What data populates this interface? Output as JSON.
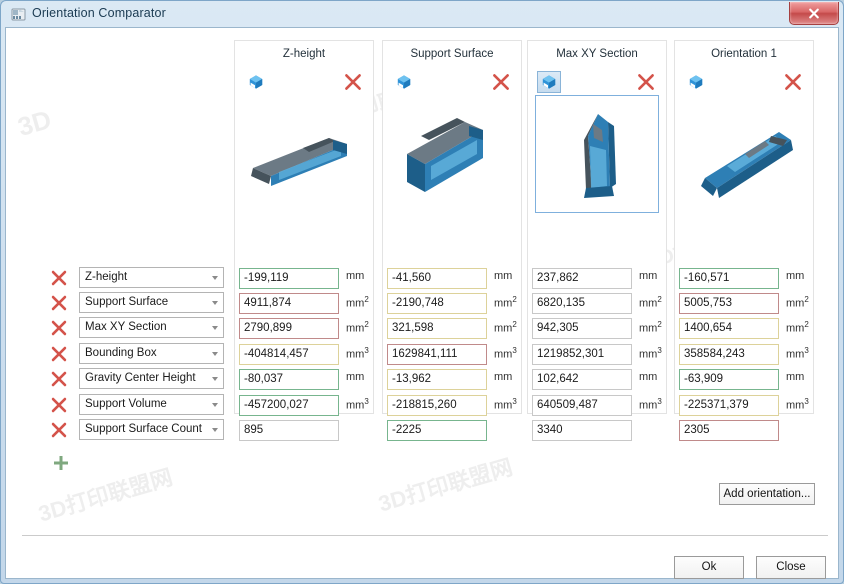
{
  "window": {
    "title": "Orientation Comparator",
    "title_icon": "app-window-icon",
    "close_icon": "close-icon"
  },
  "columns": [
    {
      "title": "Z-height",
      "cube_icon": "orientation-cube-icon",
      "remove_icon": "remove-column-icon",
      "selected": false
    },
    {
      "title": "Support Surface",
      "cube_icon": "orientation-cube-icon",
      "remove_icon": "remove-column-icon",
      "selected": false
    },
    {
      "title": "Max XY Section",
      "cube_icon": "orientation-cube-icon",
      "remove_icon": "remove-column-icon",
      "selected": true
    },
    {
      "title": "Orientation 1",
      "cube_icon": "orientation-cube-icon",
      "remove_icon": "remove-column-icon",
      "selected": false
    }
  ],
  "criteria": [
    {
      "label": "Z-height",
      "unit": "mm",
      "unit_exp": ""
    },
    {
      "label": "Support Surface",
      "unit": "mm",
      "unit_exp": "2"
    },
    {
      "label": "Max XY Section",
      "unit": "mm",
      "unit_exp": "2"
    },
    {
      "label": "Bounding Box",
      "unit": "mm",
      "unit_exp": "3"
    },
    {
      "label": "Gravity Center Height",
      "unit": "mm",
      "unit_exp": ""
    },
    {
      "label": "Support Volume",
      "unit": "mm",
      "unit_exp": "3"
    },
    {
      "label": "Support Surface Count",
      "unit": "",
      "unit_exp": ""
    }
  ],
  "values": [
    [
      {
        "v": "-199,119",
        "state": "good"
      },
      {
        "v": "4911,874",
        "state": "bad"
      },
      {
        "v": "2790,899",
        "state": "bad"
      },
      {
        "v": "-404814,457",
        "state": "mid"
      },
      {
        "v": "-80,037",
        "state": "good"
      },
      {
        "v": "-457200,027",
        "state": "good"
      },
      {
        "v": "895",
        "state": "plain"
      }
    ],
    [
      {
        "v": "-41,560",
        "state": "mid"
      },
      {
        "v": "-2190,748",
        "state": "mid"
      },
      {
        "v": "321,598",
        "state": "mid"
      },
      {
        "v": "1629841,111",
        "state": "bad"
      },
      {
        "v": "-13,962",
        "state": "mid"
      },
      {
        "v": "-218815,260",
        "state": "mid"
      },
      {
        "v": "-2225",
        "state": "good"
      }
    ],
    [
      {
        "v": "237,862",
        "state": "plain"
      },
      {
        "v": "6820,135",
        "state": "plain"
      },
      {
        "v": "942,305",
        "state": "plain"
      },
      {
        "v": "1219852,301",
        "state": "plain"
      },
      {
        "v": "102,642",
        "state": "plain"
      },
      {
        "v": "640509,487",
        "state": "plain"
      },
      {
        "v": "3340",
        "state": "plain"
      }
    ],
    [
      {
        "v": "-160,571",
        "state": "good"
      },
      {
        "v": "5005,753",
        "state": "bad"
      },
      {
        "v": "1400,654",
        "state": "mid"
      },
      {
        "v": "358584,243",
        "state": "mid"
      },
      {
        "v": "-63,909",
        "state": "good"
      },
      {
        "v": "-225371,379",
        "state": "mid"
      },
      {
        "v": "2305",
        "state": "bad"
      }
    ]
  ],
  "actions": {
    "add_criterion_icon": "plus-icon",
    "add_orientation_label": "Add orientation...",
    "ok_label": "Ok",
    "close_label": "Close"
  },
  "row_remove_icon": "remove-criterion-icon",
  "watermark": "3D 打印联盟网"
}
